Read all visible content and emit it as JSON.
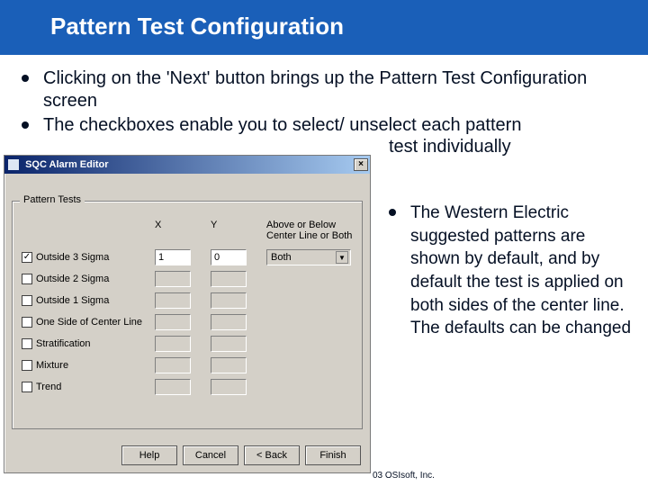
{
  "slide_title": "Pattern Test Configuration",
  "bullets": {
    "b1": "Clicking on the 'Next' button brings up the Pattern Test Configuration screen",
    "b2": "The checkboxes enable you to select/ unselect each pattern",
    "b2_cont": "test individually",
    "b3": "The Western Electric suggested patterns are shown by default, and by default the test is applied on both sides of the center line. The defaults can be changed"
  },
  "copyright": "03 OSIsoft, Inc.",
  "dialog": {
    "title": "SQC Alarm Editor",
    "close_glyph": "×",
    "group_label": "Pattern Tests",
    "columns": {
      "x": "X",
      "y": "Y",
      "ab_line1": "Above or Below",
      "ab_line2": "Center Line or Both"
    },
    "rows": [
      {
        "checked": true,
        "label": "Outside 3 Sigma",
        "x": "1",
        "y": "0",
        "sel": "Both"
      },
      {
        "checked": false,
        "label": "Outside 2 Sigma",
        "x": "",
        "y": "",
        "sel": ""
      },
      {
        "checked": false,
        "label": "Outside 1 Sigma",
        "x": "",
        "y": "",
        "sel": ""
      },
      {
        "checked": false,
        "label": "One Side of Center Line",
        "x": "",
        "y": "",
        "sel": ""
      },
      {
        "checked": false,
        "label": "Stratification",
        "x": "",
        "y": "",
        "sel": ""
      },
      {
        "checked": false,
        "label": "Mixture",
        "x": "",
        "y": "",
        "sel": ""
      },
      {
        "checked": false,
        "label": "Trend",
        "x": "",
        "y": "",
        "sel": ""
      }
    ],
    "buttons": {
      "help": "Help",
      "cancel": "Cancel",
      "back": "< Back",
      "finish": "Finish"
    },
    "arrow_glyph": "▼",
    "check_glyph": "✓"
  }
}
